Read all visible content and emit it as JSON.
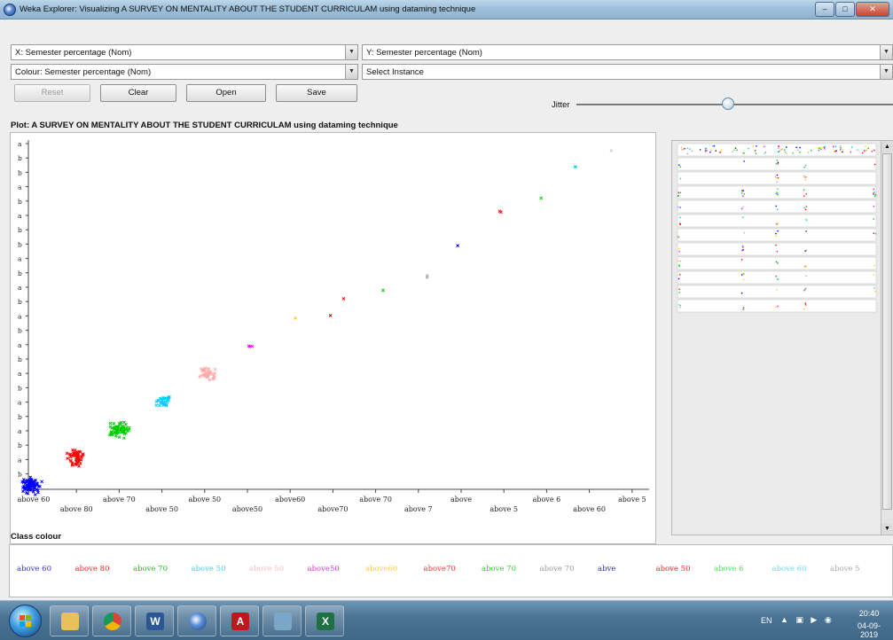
{
  "window": {
    "title": "Weka Explorer: Visualizing A SURVEY ON MENTALITY ABOUT THE STUDENT CURRICULAM using dataming technique"
  },
  "controls": {
    "x_axis": "X: Semester percentage (Nom)",
    "y_axis": "Y: Semester percentage (Nom)",
    "colour": "Colour: Semester percentage (Nom)",
    "instance": "Select Instance",
    "reset_label": "Reset",
    "clear_label": "Clear",
    "open_label": "Open",
    "save_label": "Save",
    "jitter_label": "Jitter",
    "jitter_value": 0.48
  },
  "plot": {
    "title": "Plot: A SURVEY ON MENTALITY ABOUT THE STUDENT CURRICULAM using dataming technique"
  },
  "chart_data": {
    "type": "scatter",
    "title": "Plot: A SURVEY ON MENTALITY ABOUT THE STUDENT CURRICULAM using dataming technique",
    "xlabel": "",
    "ylabel": "",
    "x_tick_labels": [
      "above 60",
      "above 80",
      "above 70",
      "above 50",
      "above 50",
      "above50",
      "above60",
      "above70",
      "above 70",
      "above 7",
      "above",
      "above 5",
      "above 6",
      "above 60",
      "above 5"
    ],
    "y_tick_labels": [
      "a",
      "b",
      "b",
      "a",
      "b",
      "a",
      "b",
      "b",
      "a",
      "b",
      "a",
      "b",
      "a",
      "b",
      "a",
      "b",
      "a",
      "b",
      "a",
      "b",
      "a",
      "b",
      "a",
      "b"
    ],
    "grid": false,
    "points": [
      {
        "x": 0,
        "y": 0,
        "color": "#0000ff",
        "count": 90,
        "spread": 1
      },
      {
        "x": 1,
        "y": 1,
        "color": "#ff0000",
        "count": 55,
        "spread": 1
      },
      {
        "x": 2,
        "y": 2,
        "color": "#00cc00",
        "count": 75,
        "spread": 1
      },
      {
        "x": 3,
        "y": 3,
        "color": "#00ccff",
        "count": 30,
        "spread": 0.8
      },
      {
        "x": 4,
        "y": 4,
        "color": "#ffaaaa",
        "count": 40,
        "spread": 0.9
      },
      {
        "x": 5,
        "y": 5,
        "color": "#ff00ff",
        "count": 3,
        "spread": 0.4
      },
      {
        "x": 6,
        "y": 6,
        "color": "#ffcc00",
        "count": 1,
        "spread": 0.1
      },
      {
        "x": 6.8,
        "y": 6.1,
        "color": "#ff0000",
        "count": 1,
        "spread": 0.1
      },
      {
        "x": 7.1,
        "y": 6.7,
        "color": "#ff0000",
        "count": 1,
        "spread": 0.1
      },
      {
        "x": 8,
        "y": 7,
        "color": "#00cc00",
        "count": 1,
        "spread": 0.1
      },
      {
        "x": 9,
        "y": 7.5,
        "color": "#aaaaaa",
        "count": 2,
        "spread": 0.3
      },
      {
        "x": 9.7,
        "y": 8.6,
        "color": "#0000ff",
        "count": 1,
        "spread": 0.1
      },
      {
        "x": 10.7,
        "y": 9.8,
        "color": "#ff0000",
        "count": 2,
        "spread": 0.3
      },
      {
        "x": 11.6,
        "y": 10.3,
        "color": "#00cc00",
        "count": 1,
        "spread": 0.1
      },
      {
        "x": 12.4,
        "y": 11.4,
        "color": "#00ccff",
        "count": 2,
        "spread": 0.3
      },
      {
        "x": 13.2,
        "y": 12,
        "color": "#cccccc",
        "count": 1,
        "spread": 0.1
      }
    ]
  },
  "class_colour": {
    "label": "Class colour",
    "items": [
      {
        "label": "above 60",
        "color": "#3333cc"
      },
      {
        "label": "above 80",
        "color": "#ee2222"
      },
      {
        "label": "above 70",
        "color": "#22bb22"
      },
      {
        "label": "above 50",
        "color": "#44ccee"
      },
      {
        "label": "above 50",
        "color": "#ffbbbb"
      },
      {
        "label": "above50",
        "color": "#dd33dd"
      },
      {
        "label": "above60",
        "color": "#ffcc33"
      },
      {
        "label": "above70",
        "color": "#ee3333"
      },
      {
        "label": "above 70",
        "color": "#33cc33"
      },
      {
        "label": "above 70",
        "color": "#999999"
      },
      {
        "label": "abve",
        "color": "#2233aa"
      },
      {
        "label": "above 50",
        "color": "#ee2222"
      },
      {
        "label": "above 6",
        "color": "#55dd55"
      },
      {
        "label": "above 60",
        "color": "#66ddee"
      },
      {
        "label": "above 5",
        "color": "#aaaaaa"
      }
    ]
  },
  "taskbar": {
    "language": "EN",
    "time": "20:40",
    "date": "04-09-2019"
  }
}
